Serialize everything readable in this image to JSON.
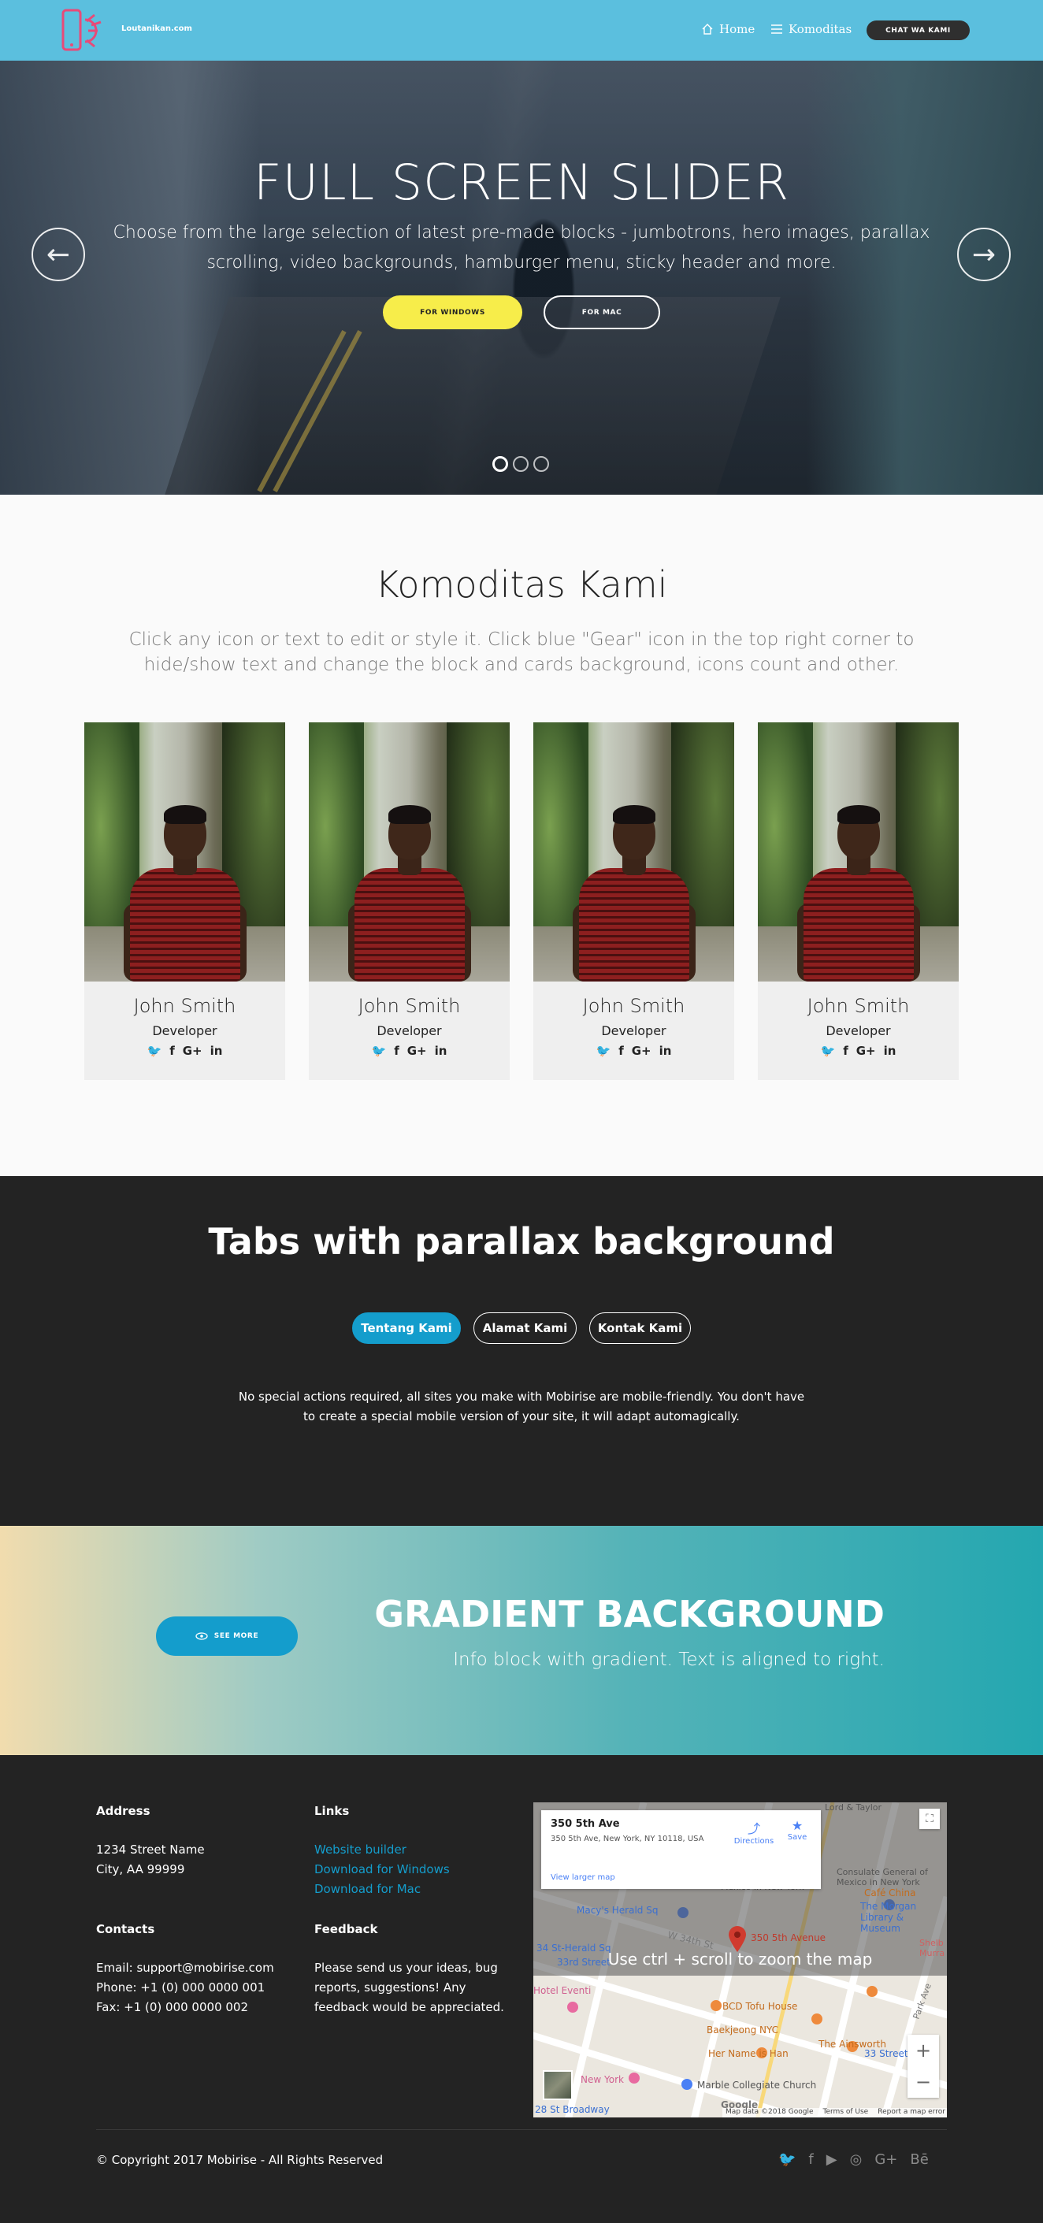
{
  "navbar": {
    "brand": "Loutanikan.com",
    "home": "Home",
    "komoditas": "Komoditas",
    "cta": "CHAT WA KAMI",
    "home_icon": "home-icon",
    "komoditas_icon": "menu-icon"
  },
  "hero": {
    "title": "FULL SCREEN SLIDER",
    "subtitle": "Choose from the large selection of latest pre-made blocks - jumbotrons, hero images, parallax scrolling, video backgrounds, hamburger menu, sticky header and more.",
    "btn_windows": "FOR WINDOWS",
    "btn_mac": "FOR MAC",
    "prev": "←",
    "next": "→",
    "active_slide": 1,
    "slide_count": 3
  },
  "team": {
    "title": "Komoditas Kami",
    "subtitle": "Click any icon or text to edit or style it. Click blue \"Gear\" icon in the top right corner to hide/show text and change the block and cards background, icons count and other.",
    "members": [
      {
        "name": "John Smith",
        "role": "Developer"
      },
      {
        "name": "John Smith",
        "role": "Developer"
      },
      {
        "name": "John Smith",
        "role": "Developer"
      },
      {
        "name": "John Smith",
        "role": "Developer"
      }
    ],
    "social_glyphs": {
      "twitter": "🐦",
      "facebook": "f",
      "google": "G+",
      "linkedin": "in"
    }
  },
  "tabs": {
    "title": "Tabs with parallax background",
    "items": [
      "Tentang Kami",
      "Alamat Kami",
      "Kontak Kami"
    ],
    "active": 0,
    "content": "No special actions required, all sites you make with Mobirise are mobile-friendly. You don't have to create a special mobile version of your site, it will adapt automagically."
  },
  "gradient": {
    "button": "SEE MORE",
    "title": "GRADIENT BACKGROUND",
    "subtitle": "Info block with gradient. Text is aligned to right."
  },
  "footer": {
    "address_head": "Address",
    "address_line1": "1234 Street Name",
    "address_line2": "City, AA 99999",
    "links_head": "Links",
    "links": [
      "Website builder",
      "Download for Windows",
      "Download for Mac"
    ],
    "contacts_head": "Contacts",
    "email": "Email: support@mobirise.com",
    "phone": "Phone: +1 (0) 000 0000 001",
    "fax": "Fax: +1 (0) 000 0000 002",
    "feedback_head": "Feedback",
    "feedback_text": "Please send us your ideas, bug reports, suggestions! Any feedback would be appreciated.",
    "copyright": "© Copyright 2017 Mobirise - All Rights Reserved",
    "socials": [
      "twitter-icon",
      "facebook-icon",
      "youtube-icon",
      "instagram-icon",
      "google-plus-icon",
      "behance-icon"
    ]
  },
  "map": {
    "place_name": "350 5th Ave",
    "place_address": "350 5th Ave, New York, NY 10118, USA",
    "directions": "Directions",
    "save": "Save",
    "view_larger": "View larger map",
    "overlay_msg": "Use ctrl + scroll to zoom the map",
    "marker_label": "350 5th Avenue",
    "labels": [
      "Lord & Taylor",
      "Consulate General of Mexico in New York",
      "Café China",
      "Macy's Herald Sq",
      "34 St-Herald Sq",
      "33rd Street",
      "W 34th St",
      "The Morgan Library & Museum",
      "Shelb Murra",
      "BCD Tofu House",
      "Baekjeong NYC",
      "The Ainsworth",
      "Her Name is Han",
      "33 Street",
      "Marble Collegiate Church",
      "New York",
      "28 St Broadway",
      "Hotel Eventi",
      "Park Ave"
    ],
    "attribution": "Map data ©2018 Google",
    "terms": "Terms of Use",
    "report": "Report a map error",
    "google": "Google",
    "zoom_in": "+",
    "zoom_out": "−"
  }
}
